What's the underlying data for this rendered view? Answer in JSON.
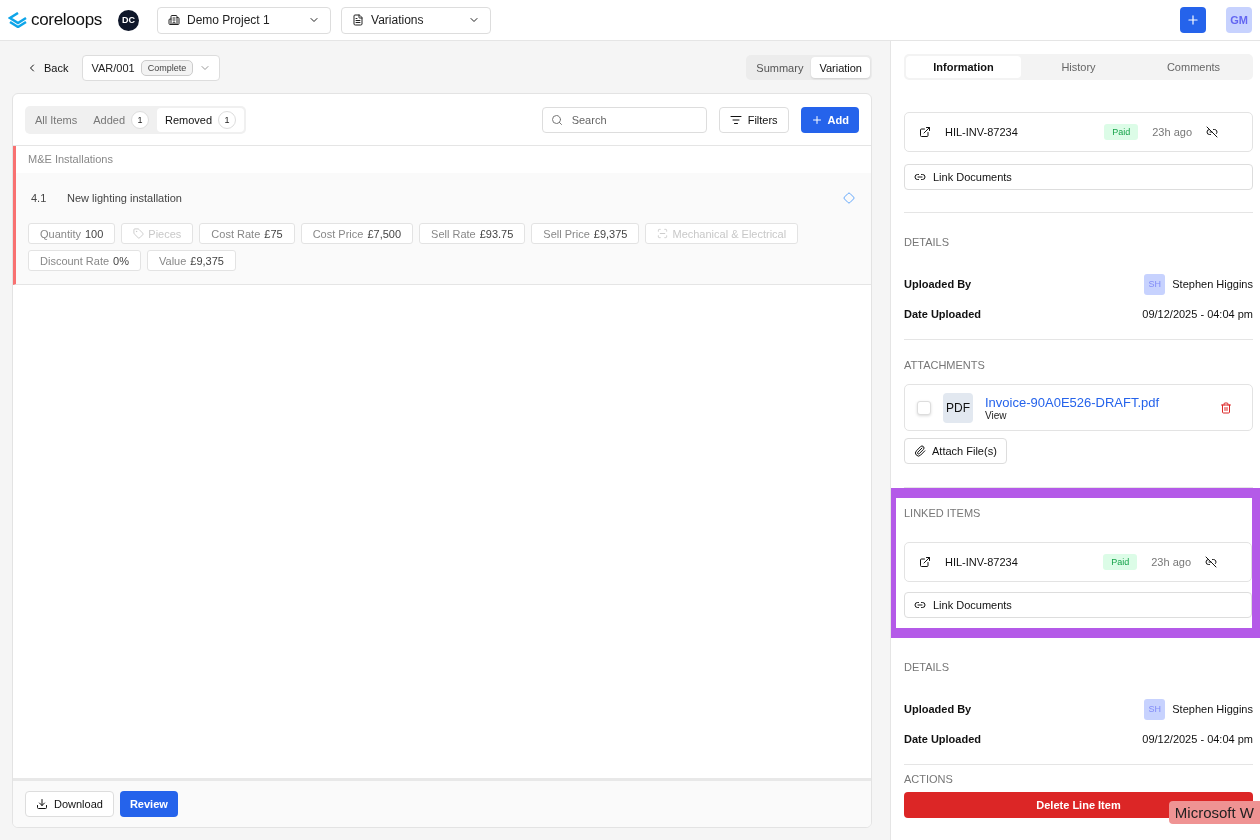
{
  "header": {
    "brand": "coreloops",
    "workspace_initials": "DC",
    "project": "Demo Project 1",
    "module": "Variations",
    "user_initials": "GM"
  },
  "variation": {
    "back": "Back",
    "id": "VAR/001",
    "status": "Complete"
  },
  "view_toggle": [
    {
      "label": "Summary",
      "selected": false
    },
    {
      "label": "Variation",
      "selected": true
    }
  ],
  "filter_tabs": [
    {
      "label": "All Items",
      "selected": false
    },
    {
      "label": "Added",
      "count": "1",
      "selected": false
    },
    {
      "label": "Removed",
      "count": "1",
      "selected": true
    }
  ],
  "toolbar": {
    "search_placeholder": "Search",
    "filters": "Filters",
    "add": "Add"
  },
  "group": {
    "title": "M&E Installations",
    "items": [
      {
        "number": "4.1",
        "name": "New lighting installation",
        "fields": [
          {
            "kind": "field",
            "label": "Quantity",
            "value": "100"
          },
          {
            "kind": "unit",
            "label": "Pieces",
            "disabled": true
          },
          {
            "kind": "field",
            "label": "Cost Rate",
            "value": "£75"
          },
          {
            "kind": "field",
            "label": "Cost Price",
            "value": "£7,500"
          },
          {
            "kind": "field",
            "label": "Sell Rate",
            "value": "£93.75"
          },
          {
            "kind": "field",
            "label": "Sell Price",
            "value": "£9,375"
          },
          {
            "kind": "category",
            "label": "Mechanical & Electrical",
            "disabled": true
          },
          {
            "kind": "field",
            "label": "Discount Rate",
            "value": "0%"
          },
          {
            "kind": "field",
            "label": "Value",
            "value": "£9,375"
          }
        ]
      }
    ]
  },
  "footer": {
    "download": "Download",
    "review": "Review"
  },
  "panel_tabs": [
    {
      "label": "Information",
      "selected": true
    },
    {
      "label": "History",
      "selected": false
    },
    {
      "label": "Comments",
      "selected": false
    }
  ],
  "panel_sections": [
    {
      "kind": "linked",
      "highlighted": false,
      "items": [
        {
          "code": "HIL-INV-87234",
          "status": "Paid",
          "time": "23h ago"
        }
      ],
      "link_button": "Link Documents"
    },
    {
      "kind": "details",
      "title": "DETAILS",
      "rows": [
        {
          "label": "Uploaded By",
          "initials": "SH",
          "value": "Stephen Higgins"
        },
        {
          "label": "Date Uploaded",
          "value": "09/12/2025 - 04:04 pm"
        }
      ]
    },
    {
      "kind": "attachments",
      "title": "ATTACHMENTS",
      "files": [
        {
          "type": "PDF",
          "name": "Invoice-90A0E526-DRAFT.pdf",
          "action": "View",
          "checked": false
        }
      ],
      "attach_button": "Attach File(s)"
    },
    {
      "kind": "linked",
      "title": "LINKED ITEMS",
      "highlighted": true,
      "items": [
        {
          "code": "HIL-INV-87234",
          "status": "Paid",
          "time": "23h ago"
        }
      ],
      "link_button": "Link Documents"
    },
    {
      "kind": "details",
      "title": "DETAILS",
      "rows": [
        {
          "label": "Uploaded By",
          "initials": "SH",
          "value": "Stephen Higgins"
        },
        {
          "label": "Date Uploaded",
          "value": "09/12/2025 - 04:04 pm"
        }
      ]
    },
    {
      "kind": "actions",
      "title": "ACTIONS",
      "button": "Delete Line Item"
    }
  ],
  "tooltip": "Microsoft W"
}
